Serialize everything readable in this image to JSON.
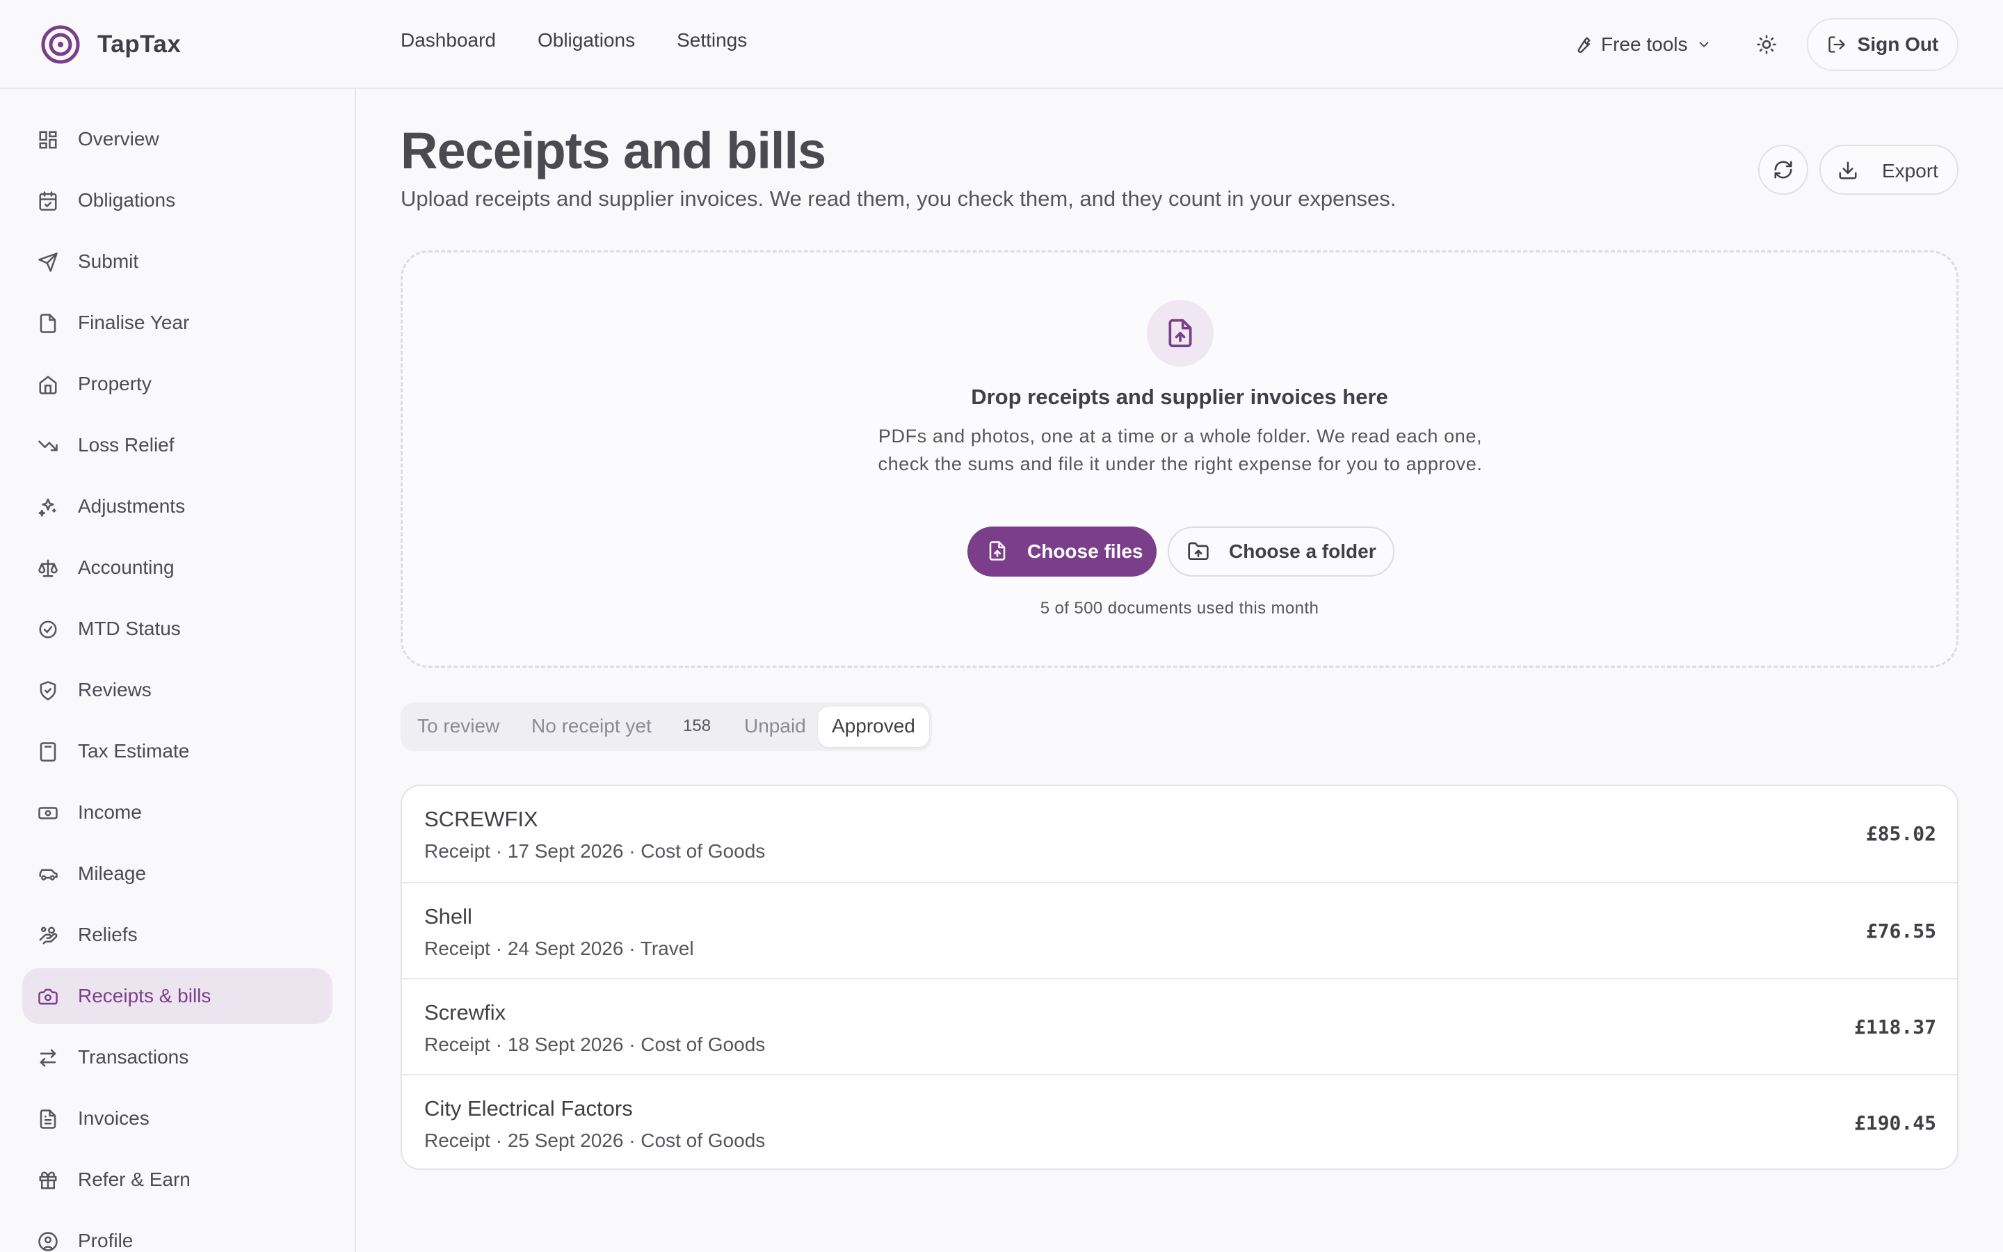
{
  "app": {
    "name": "TapTax"
  },
  "topnav": {
    "dashboard": "Dashboard",
    "obligations": "Obligations",
    "settings": "Settings"
  },
  "header": {
    "free_tools": "Free tools",
    "sign_out": "Sign Out"
  },
  "sidebar": {
    "items": [
      {
        "label": "Overview",
        "icon": "grid-icon"
      },
      {
        "label": "Obligations",
        "icon": "calendar-check-icon"
      },
      {
        "label": "Submit",
        "icon": "send-icon"
      },
      {
        "label": "Finalise Year",
        "icon": "document-icon"
      },
      {
        "label": "Property",
        "icon": "home-icon"
      },
      {
        "label": "Loss Relief",
        "icon": "trending-down-icon"
      },
      {
        "label": "Adjustments",
        "icon": "sparkles-icon"
      },
      {
        "label": "Accounting",
        "icon": "scale-icon"
      },
      {
        "label": "MTD Status",
        "icon": "check-circle-icon"
      },
      {
        "label": "Reviews",
        "icon": "shield-check-icon"
      },
      {
        "label": "Tax Estimate",
        "icon": "calculator-icon"
      },
      {
        "label": "Income",
        "icon": "banknote-icon"
      },
      {
        "label": "Mileage",
        "icon": "car-icon"
      },
      {
        "label": "Reliefs",
        "icon": "hand-coins-icon"
      },
      {
        "label": "Receipts & bills",
        "icon": "camera-icon"
      },
      {
        "label": "Transactions",
        "icon": "arrows-swap-icon"
      },
      {
        "label": "Invoices",
        "icon": "file-text-icon"
      },
      {
        "label": "Refer & Earn",
        "icon": "gift-icon"
      },
      {
        "label": "Profile",
        "icon": "user-circle-icon"
      }
    ],
    "active_index": 14
  },
  "page": {
    "title": "Receipts and bills",
    "subtitle": "Upload receipts and supplier invoices. We read them, you check them, and they count in your expenses.",
    "export_label": "Export"
  },
  "dropzone": {
    "title": "Drop receipts and supplier invoices here",
    "description": "PDFs and photos, one at a time or a whole folder. We read each one, check the sums and file it under the right expense for you to approve.",
    "choose_files": "Choose files",
    "choose_folder": "Choose a folder",
    "usage": "5 of 500 documents used this month"
  },
  "tabs": {
    "to_review": "To review",
    "no_receipt": "No receipt yet",
    "no_receipt_count": "158",
    "unpaid": "Unpaid",
    "approved": "Approved",
    "active": "approved"
  },
  "receipts": [
    {
      "name": "SCREWFIX",
      "meta": "Receipt · 17 Sept 2026 · Cost of Goods",
      "amount": "£85.02"
    },
    {
      "name": "Shell",
      "meta": "Receipt · 24 Sept 2026 · Travel",
      "amount": "£76.55"
    },
    {
      "name": "Screwfix",
      "meta": "Receipt · 18 Sept 2026 · Cost of Goods",
      "amount": "£118.37"
    },
    {
      "name": "City Electrical Factors",
      "meta": "Receipt · 25 Sept 2026 · Cost of Goods",
      "amount": "£190.45"
    }
  ],
  "colors": {
    "brand": "#7a3e8a",
    "active_bg": "#ece5ef",
    "background": "#f9f9fb"
  }
}
